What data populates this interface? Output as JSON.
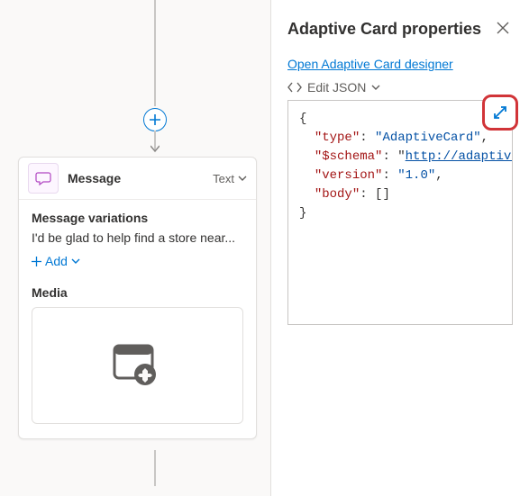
{
  "canvas": {
    "message_node": {
      "title": "Message",
      "type_label": "Text"
    },
    "variations": {
      "section_title": "Message variations",
      "text": "I'd be glad to help find a store near...",
      "add_label": "Add"
    },
    "media": {
      "section_title": "Media"
    }
  },
  "panel": {
    "title": "Adaptive Card properties",
    "open_designer_link": "Open Adaptive Card designer",
    "edit_json_label": "Edit JSON",
    "json": {
      "brace_open": "{",
      "type_key": "\"type\"",
      "type_val": "\"AdaptiveCard\"",
      "schema_key": "\"$schema\"",
      "schema_val": "http://adaptivecards.i",
      "version_key": "\"version\"",
      "version_val": "\"1.0\"",
      "body_key": "\"body\"",
      "body_val": "[]",
      "brace_close": "}"
    }
  }
}
